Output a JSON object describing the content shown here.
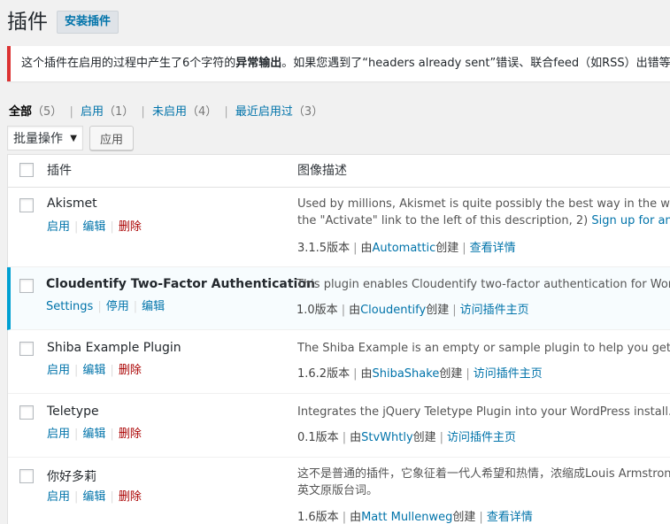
{
  "header": {
    "title": "插件",
    "add_new": "安装插件"
  },
  "notice": {
    "pre": "这个插件在启用的过程中产生了6个字符的",
    "strong": "异常输出",
    "post": "。如果您遇到了“headers already sent”错误、联合feed（如RSS）出错等问题"
  },
  "filters": {
    "all": "全部",
    "all_count": "（5）",
    "active": "启用",
    "active_count": "（1）",
    "inactive": "未启用",
    "inactive_count": "（4）",
    "recent": "最近启用过",
    "recent_count": "（3）",
    "sep": "|"
  },
  "bulk": {
    "select": "批量操作",
    "apply": "应用"
  },
  "table": {
    "col_name": "插件",
    "col_desc": "图像描述"
  },
  "plugins": [
    {
      "name": "Akismet",
      "actions": [
        "启用",
        "编辑",
        "删除"
      ],
      "desc1": "Used by millions, Akismet is quite possibly the best way in the world to",
      "desc2a": "the \"Activate\" link to the left of this description, 2) ",
      "desc2link": "Sign up for an Akismet",
      "version": "3.1.5版本",
      "by": "由",
      "author": "Automattic",
      "created": "创建",
      "detail": "查看详情"
    },
    {
      "name": "Cloudentify Two-Factor Authentication",
      "actions": [
        "Settings",
        "停用",
        "编辑"
      ],
      "desc1": "This plugin enables Cloudentify two-factor authentication for WordPress",
      "version": "1.0版本",
      "by": "由",
      "author": "Cloudentify",
      "created": "创建",
      "detail": "访问插件主页"
    },
    {
      "name": "Shiba Example Plugin",
      "actions": [
        "启用",
        "编辑",
        "删除"
      ],
      "desc1": "The Shiba Example is an empty or sample plugin to help you get started",
      "version": "1.6.2版本",
      "by": "由",
      "author": "ShibaShake",
      "created": "创建",
      "detail": "访问插件主页"
    },
    {
      "name": "Teletype",
      "actions": [
        "启用",
        "编辑",
        "删除"
      ],
      "desc1": "Integrates the jQuery Teletype Plugin into your WordPress install.",
      "version": "0.1版本",
      "by": "由",
      "author": "StvWhtly",
      "created": "创建",
      "detail": "访问插件主页"
    },
    {
      "name": "你好多莉",
      "actions": [
        "启用",
        "编辑",
        "删除"
      ],
      "desc1": "这不是普通的插件，它象征着一代人希望和热情，浓缩成Louis Armstrong",
      "desc2": "英文原版台词。",
      "version": "1.6版本",
      "by": "由",
      "author": "Matt Mullenweg",
      "created": "创建",
      "detail": "查看详情"
    }
  ]
}
